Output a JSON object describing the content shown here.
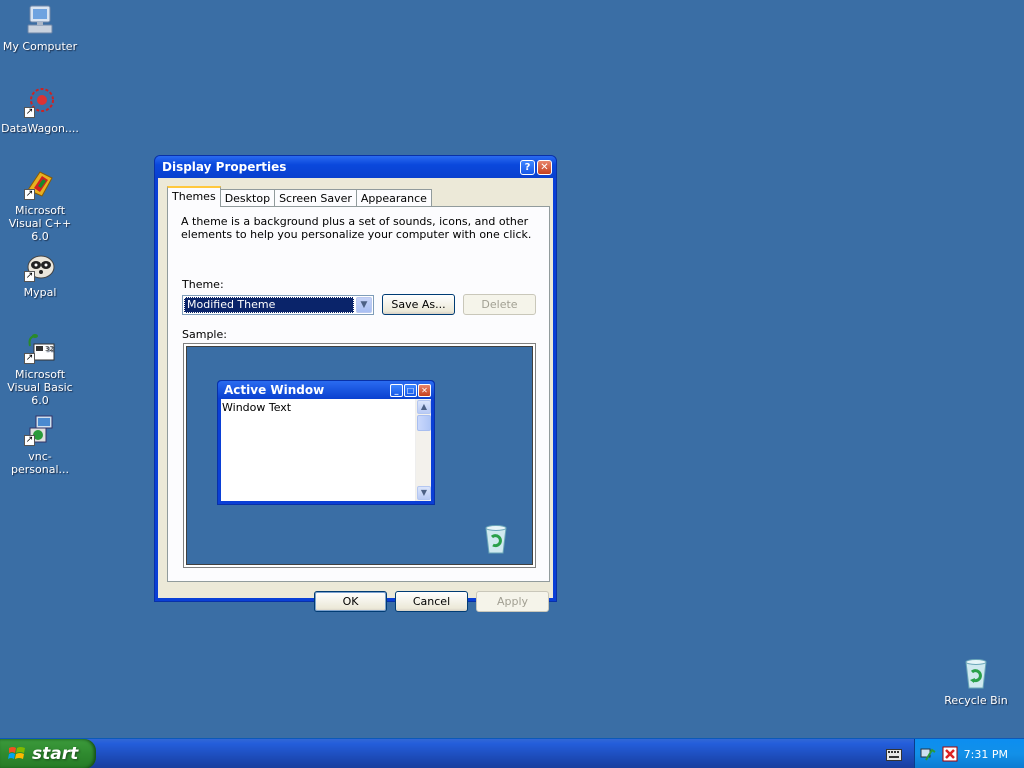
{
  "desktop": {
    "icons": [
      {
        "label": "My Computer",
        "icon": "computer-icon"
      },
      {
        "label": "DataWagon....",
        "icon": "datawagon-icon"
      },
      {
        "label": "Microsoft Visual C++ 6.0",
        "icon": "visual-cpp-icon"
      },
      {
        "label": "Mypal",
        "icon": "mypal-raccoon-icon"
      },
      {
        "label": "Microsoft Visual Basic 6.0",
        "icon": "visual-basic-icon"
      },
      {
        "label": "vnc-personal...",
        "icon": "vnc-icon"
      },
      {
        "label": "Recycle Bin",
        "icon": "recycle-bin-icon"
      }
    ]
  },
  "window": {
    "title": "Display Properties",
    "help_glyph": "?",
    "close_glyph": "✕",
    "tabs": [
      "Themes",
      "Desktop",
      "Screen Saver",
      "Appearance"
    ],
    "active_tab": "Themes",
    "description": "A theme is a background plus a set of sounds, icons, and other elements to help you personalize your computer with one click.",
    "theme_label": "Theme:",
    "theme_value": "Modified Theme",
    "save_as_label": "Save As...",
    "delete_label": "Delete",
    "sample_label": "Sample:",
    "sample": {
      "window_title": "Active Window",
      "window_text": "Window Text"
    },
    "ok_label": "OK",
    "cancel_label": "Cancel",
    "apply_label": "Apply"
  },
  "taskbar": {
    "start_label": "start",
    "clock": "7:31 PM"
  },
  "colors": {
    "desktop": "#3a6ea5",
    "title_bar": "#0a48dc",
    "dialog_face": "#ece9d8",
    "selection": "#0a246a",
    "start_button": "#2f8a2f"
  }
}
